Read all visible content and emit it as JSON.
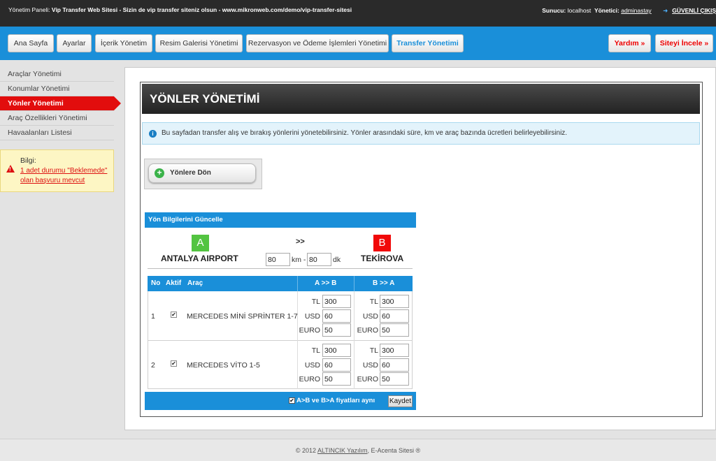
{
  "topbar": {
    "panel_label": "Yönetim Paneli:",
    "site_title": "Vip Transfer Web Sitesi - Sizin de vip transfer siteniz olsun - www.mikronweb.com/demo/vip-transfer-sitesi",
    "server_label": "Sunucu:",
    "server_value": "localhost",
    "admin_label": "Yönetici:",
    "admin_value": "adminastay",
    "logout_label": "GÜVENLİ ÇIKIŞ"
  },
  "nav": {
    "items": [
      {
        "label": "Ana Sayfa"
      },
      {
        "label": "Ayarlar"
      },
      {
        "label": "İçerik Yönetim"
      },
      {
        "label": "Resim Galerisi Yönetimi"
      },
      {
        "label": "Rezervasyon ve Ödeme İşlemleri Yönetimi"
      },
      {
        "label": "Transfer Yönetimi"
      }
    ],
    "help_label": "Yardım »",
    "view_site_label": "Siteyi İncele »"
  },
  "sidebar": {
    "items": [
      {
        "label": "Araçlar Yönetimi"
      },
      {
        "label": "Konumlar Yönetimi"
      },
      {
        "label": "Yönler Yönetimi"
      },
      {
        "label": "Araç Özellikleri Yönetimi"
      },
      {
        "label": "Havaalanları Listesi"
      }
    ],
    "info_title": "Bilgi:",
    "info_link": "1 adet durumu \"Beklemede\" olan başvuru mevcut"
  },
  "page": {
    "title": "YÖNLER YÖNETİMİ",
    "notice": "Bu sayfadan transfer alış ve bırakış yönlerini yönetebilirsiniz. Yönler arasındaki süre, km ve araç bazında ücretleri belirleyebilirsiniz.",
    "back_button": "Yönlere Dön"
  },
  "form": {
    "header": "Yön Bilgilerini Güncelle",
    "badge_a": "A",
    "badge_b": "B",
    "arrows": ">>",
    "place_a": "ANTALYA AIRPORT",
    "place_b": "TEKİROVA",
    "km_value": "80",
    "km_unit": "km -",
    "min_value": "80",
    "min_unit": "dk",
    "columns": [
      "No",
      "Aktif",
      "Araç",
      "A >> B",
      "B >> A"
    ],
    "rows": [
      {
        "no": "1",
        "vehicle": "MERCEDES MİNİ SPRİNTER 1-7",
        "ab": {
          "TL": "300",
          "USD": "60",
          "EURO": "50"
        },
        "ba": {
          "TL": "300",
          "USD": "60",
          "EURO": "50"
        }
      },
      {
        "no": "2",
        "vehicle": "MERCEDES VİTO 1-5",
        "ab": {
          "TL": "300",
          "USD": "60",
          "EURO": "50"
        },
        "ba": {
          "TL": "300",
          "USD": "60",
          "EURO": "50"
        }
      }
    ],
    "currency_labels": [
      "TL",
      "USD",
      "EURO"
    ],
    "same_prices_label": "A>B ve B>A fiyatları aynı",
    "save_label": "Kaydet"
  },
  "footer": {
    "copyright": "© 2012",
    "company": "ALTINCIK Yazılım",
    "suffix": ", E-Acenta Sitesi ®"
  },
  "colors": {
    "accent": "#1a8fd9",
    "active_red": "#e20d0d",
    "badge_a": "#53c441",
    "badge_b": "#f10909"
  }
}
